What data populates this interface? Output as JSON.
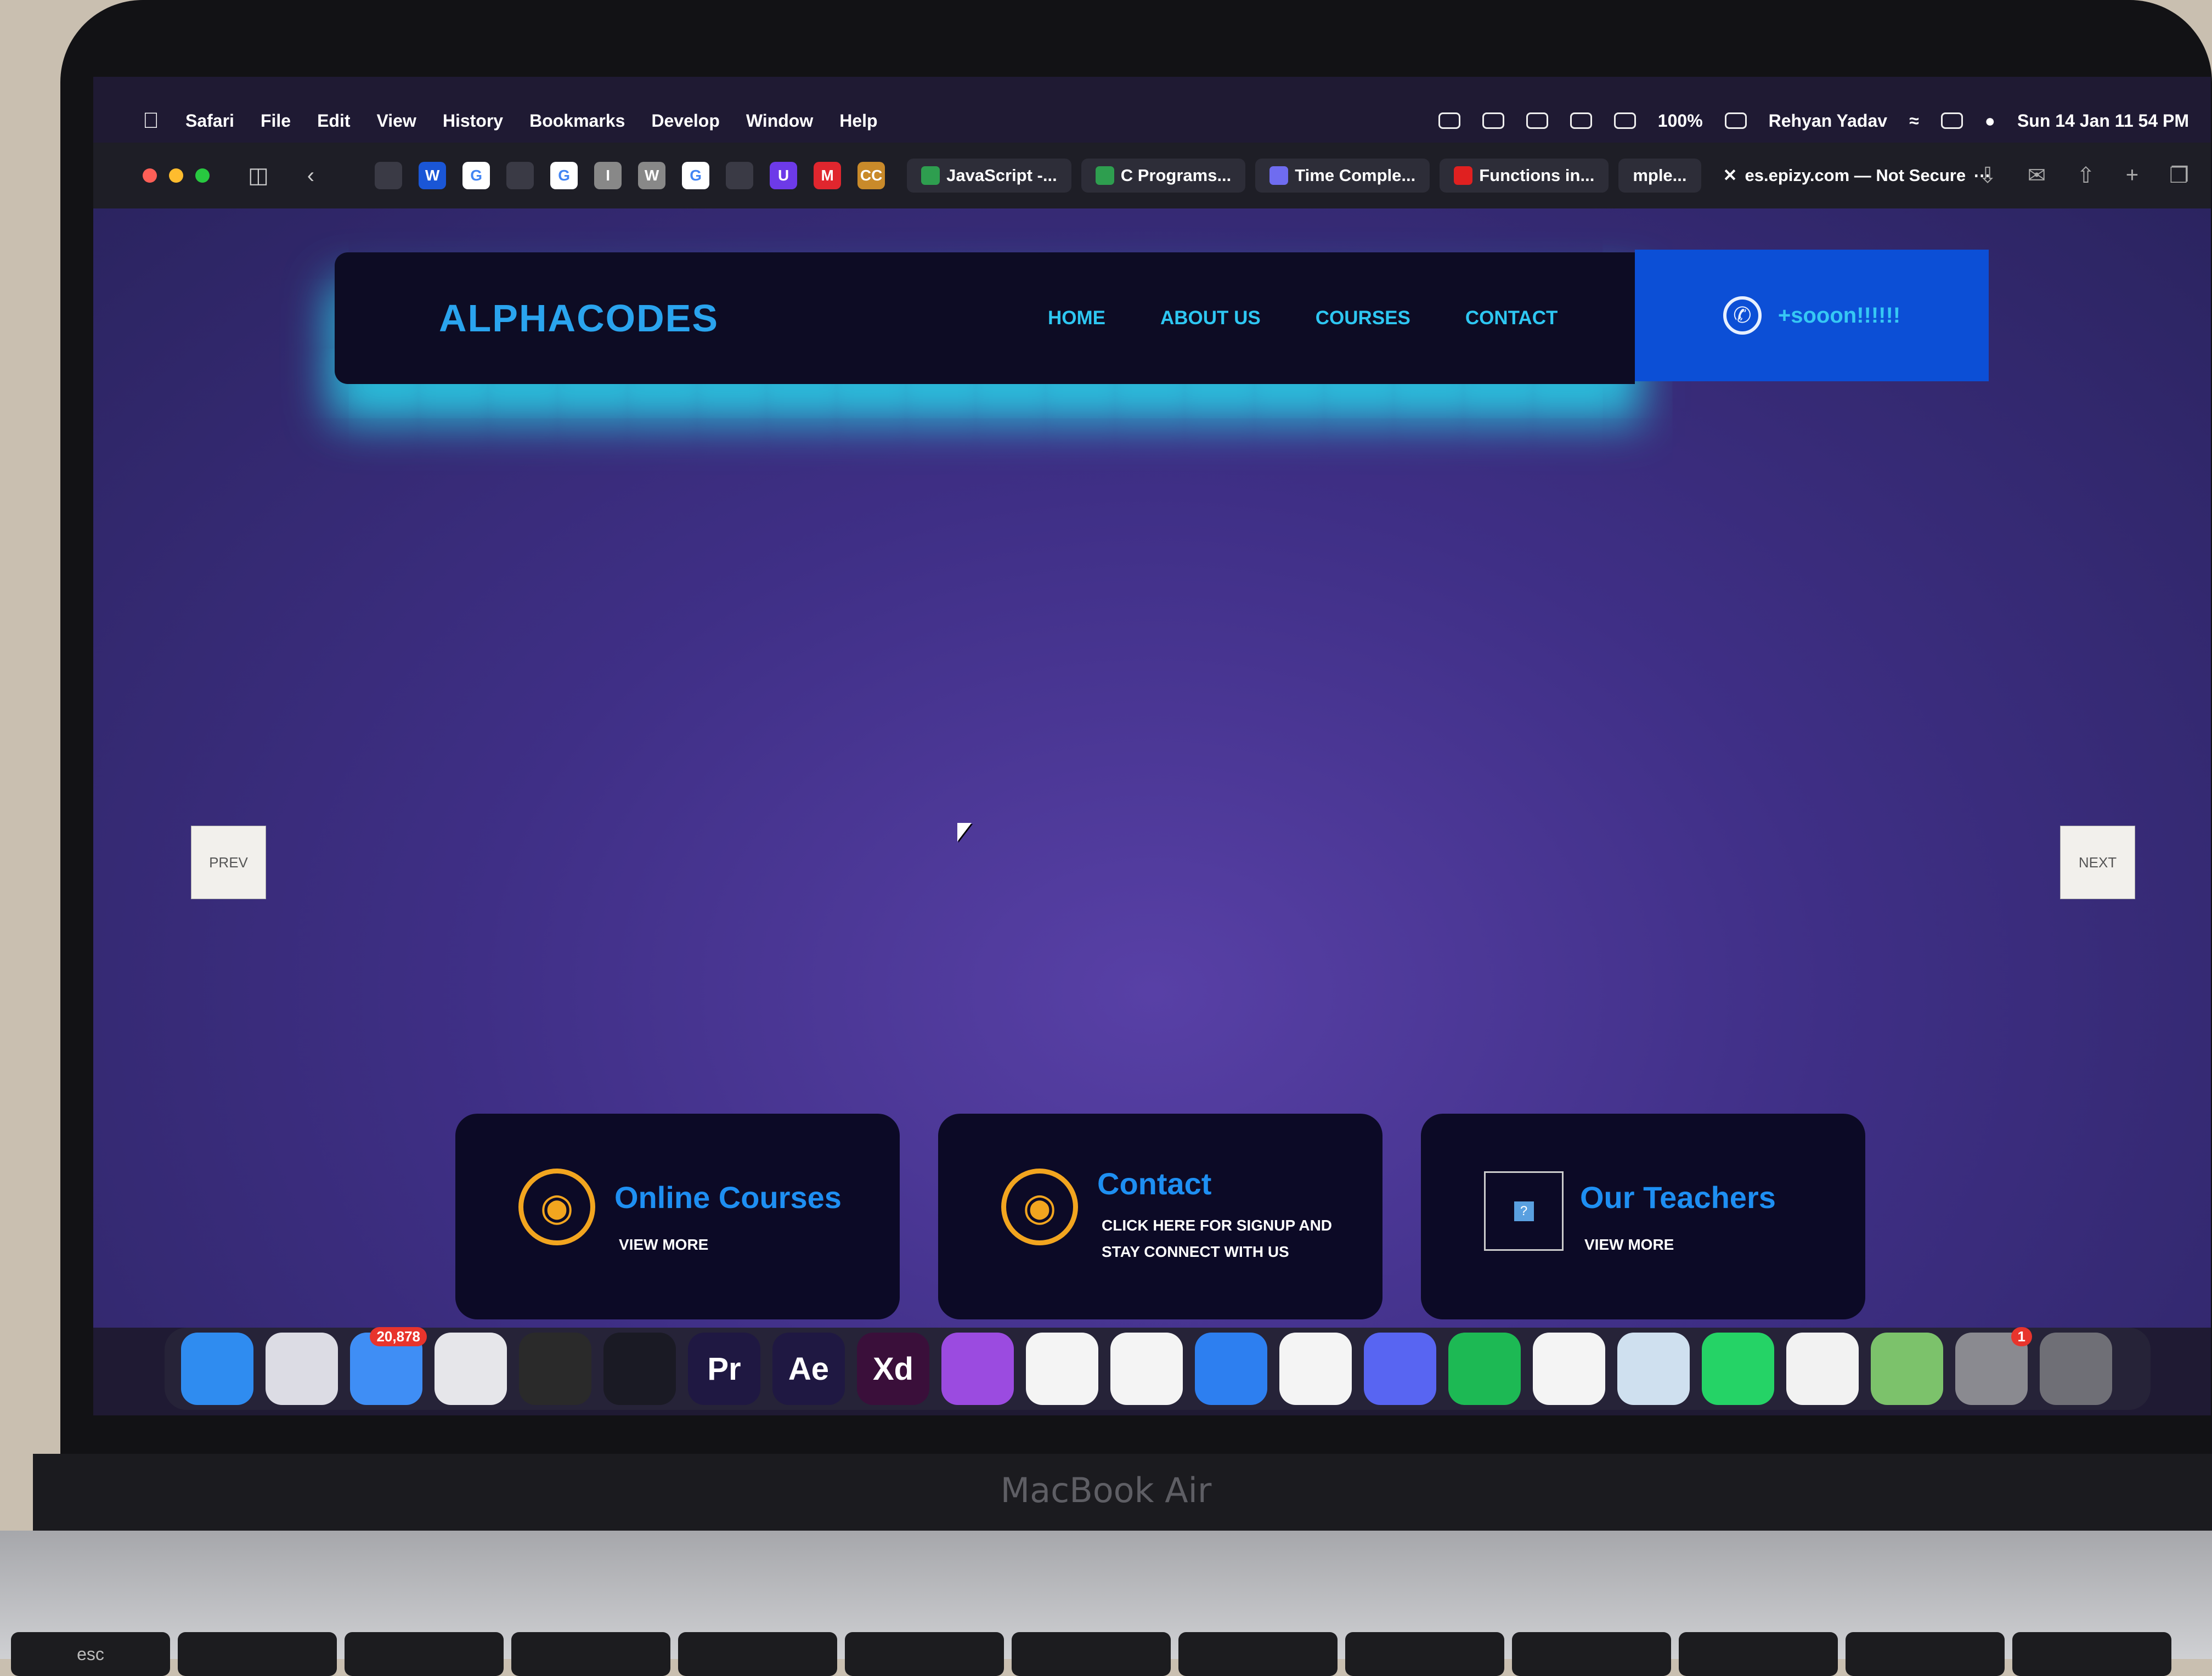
{
  "menubar": {
    "app": "Safari",
    "menus": [
      "File",
      "Edit",
      "View",
      "History",
      "Bookmarks",
      "Develop",
      "Window",
      "Help"
    ],
    "battery": "100%",
    "user": "Rehyan Yadav",
    "datetime": "Sun 14 Jan  11 54 PM"
  },
  "toolbar": {
    "favorites": [
      "",
      "W",
      "G",
      "",
      "G",
      "I",
      "W",
      "G",
      "",
      "U",
      "M",
      "CC"
    ],
    "tabs": [
      {
        "label": "JavaScript -...",
        "color": "#2e9e4f"
      },
      {
        "label": "C Programs...",
        "color": "#2e9e4f"
      },
      {
        "label": "Time Comple...",
        "color": "#6f6cf0"
      },
      {
        "label": "Functions in...",
        "color": "#e02020"
      },
      {
        "label": "mple...",
        "color": "#888888"
      }
    ],
    "address": "es.epizy.com — Not Secure"
  },
  "navbar": {
    "logo": "ALPHACODES",
    "links": [
      "HOME",
      "ABOUT US",
      "COURSES",
      "CONTACT"
    ],
    "phone": "+sooon!!!!!!"
  },
  "slider": {
    "prev": "PREV",
    "next": "NEXT"
  },
  "cards": [
    {
      "title": "Online Courses",
      "subtitle": "VIEW MORE",
      "icon": "globe-icon"
    },
    {
      "title": "Contact",
      "subtitle": "CLICK HERE FOR SIGNUP AND STAY CONNECT WITH US",
      "icon": "globe-icon"
    },
    {
      "title": "Our Teachers",
      "subtitle": "VIEW MORE",
      "icon": "broken-image-icon"
    }
  ],
  "dock": {
    "apps": [
      {
        "name": "finder",
        "label": "",
        "bg": "#2f8cf0"
      },
      {
        "name": "launchpad",
        "label": "",
        "bg": "#dcdce4"
      },
      {
        "name": "mail",
        "label": "",
        "bg": "#3f8ef5",
        "badge": "20,878"
      },
      {
        "name": "safari",
        "label": "",
        "bg": "#e6e6ea"
      },
      {
        "name": "final-cut",
        "label": "",
        "bg": "#2a2a2a"
      },
      {
        "name": "davinci",
        "label": "",
        "bg": "#1a1a24"
      },
      {
        "name": "premiere",
        "label": "Pr",
        "bg": "#1f1842"
      },
      {
        "name": "after-effects",
        "label": "Ae",
        "bg": "#1f1842"
      },
      {
        "name": "xd",
        "label": "Xd",
        "bg": "#3a0f3a"
      },
      {
        "name": "github",
        "label": "",
        "bg": "#9b4be0"
      },
      {
        "name": "mongodb",
        "label": "",
        "bg": "#f4f4f4"
      },
      {
        "name": "app-store",
        "label": "",
        "bg": "#f4f4f4"
      },
      {
        "name": "xcode",
        "label": "",
        "bg": "#2d7ff0"
      },
      {
        "name": "vscode",
        "label": "",
        "bg": "#f4f4f4"
      },
      {
        "name": "discord",
        "label": "",
        "bg": "#5865f2"
      },
      {
        "name": "spotify",
        "label": "",
        "bg": "#1db954"
      },
      {
        "name": "geeksforgeeks",
        "label": "",
        "bg": "#f4f4f4"
      },
      {
        "name": "preview",
        "label": "",
        "bg": "#cfe0ef"
      },
      {
        "name": "whatsapp",
        "label": "",
        "bg": "#25d366"
      },
      {
        "name": "textedit",
        "label": "",
        "bg": "#f2f2f2"
      },
      {
        "name": "maps",
        "label": "",
        "bg": "#7cc26b"
      },
      {
        "name": "system-settings",
        "label": "",
        "bg": "#8a8a90",
        "badge": "1"
      },
      {
        "name": "trash",
        "label": "",
        "bg": "#6f6f76"
      }
    ]
  },
  "device": {
    "label": "MacBook Air",
    "keys": [
      "esc",
      "",
      "",
      "",
      "",
      "",
      "",
      "",
      "",
      "",
      "",
      "",
      "",
      ""
    ]
  }
}
